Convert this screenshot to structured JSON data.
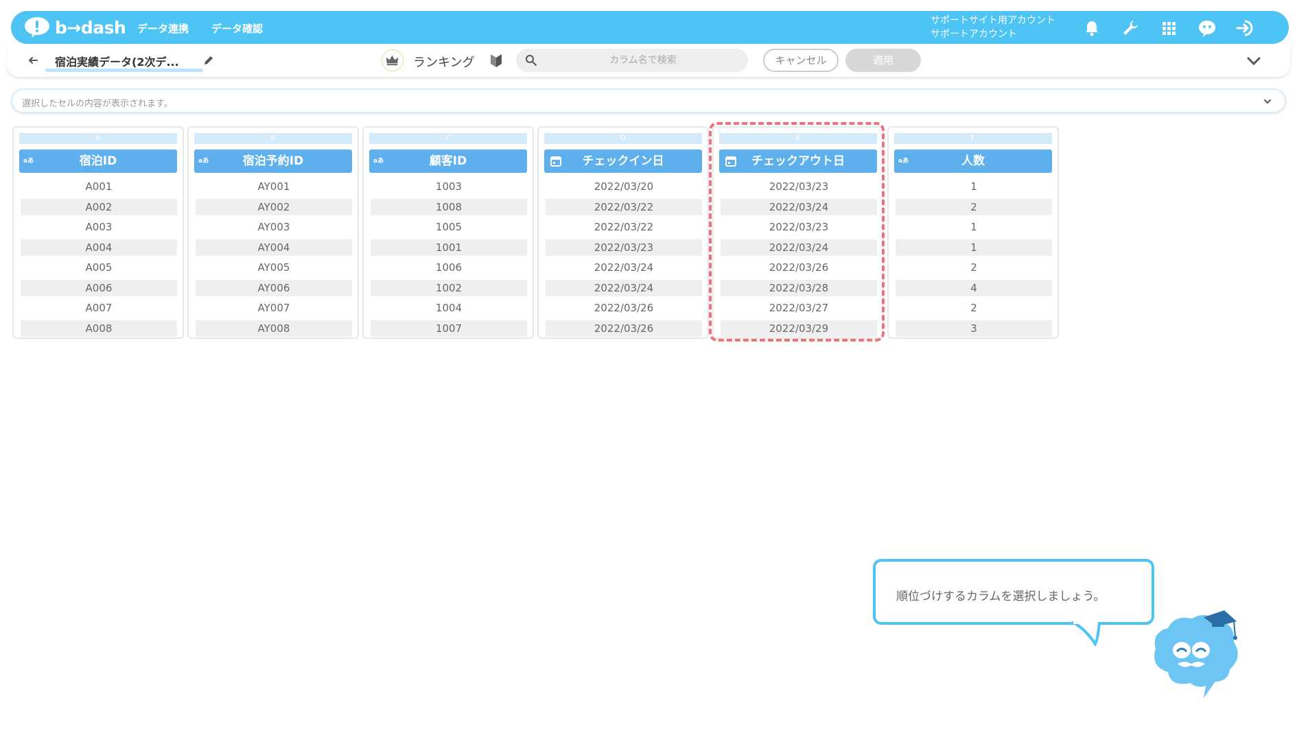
{
  "header": {
    "logo_text": "b→dash",
    "nav": [
      "データ連携",
      "データ確認"
    ],
    "account_line1": "サポートサイト用アカウント",
    "account_line2": "サポートアカウント"
  },
  "toolbar": {
    "dataset_name": "宿泊実績データ(2次デ...",
    "mode_label": "ランキング",
    "search_placeholder": "カラム名で検索",
    "cancel_label": "キャンセル",
    "apply_label": "適用"
  },
  "cellbar": {
    "placeholder": "選択したセルの内容が表示されます。"
  },
  "columns": [
    {
      "letter": "A",
      "type": "aあ",
      "name": "宿泊ID",
      "cells": [
        "A001",
        "A002",
        "A003",
        "A004",
        "A005",
        "A006",
        "A007",
        "A008"
      ]
    },
    {
      "letter": "B",
      "type": "aあ",
      "name": "宿泊予約ID",
      "cells": [
        "AY001",
        "AY002",
        "AY003",
        "AY004",
        "AY005",
        "AY006",
        "AY007",
        "AY008"
      ]
    },
    {
      "letter": "C",
      "type": "aあ",
      "name": "顧客ID",
      "cells": [
        "1003",
        "1008",
        "1005",
        "1001",
        "1006",
        "1002",
        "1004",
        "1007"
      ]
    },
    {
      "letter": "D",
      "type": "date",
      "name": "チェックイン日",
      "cells": [
        "2022/03/20",
        "2022/03/22",
        "2022/03/22",
        "2022/03/23",
        "2022/03/24",
        "2022/03/24",
        "2022/03/26",
        "2022/03/26"
      ]
    },
    {
      "letter": "E",
      "type": "date",
      "name": "チェックアウト日",
      "cells": [
        "2022/03/23",
        "2022/03/24",
        "2022/03/23",
        "2022/03/24",
        "2022/03/26",
        "2022/03/28",
        "2022/03/27",
        "2022/03/29"
      ]
    },
    {
      "letter": "F",
      "type": "aあ",
      "name": "人数",
      "cells": [
        "1",
        "2",
        "1",
        "1",
        "2",
        "4",
        "2",
        "3"
      ]
    }
  ],
  "tooltip": {
    "text": "順位づけするカラムを選択しましょう。"
  },
  "colors": {
    "brand": "#4ec4f5",
    "column_header": "#5db0ec",
    "highlight": "#f0707c"
  }
}
